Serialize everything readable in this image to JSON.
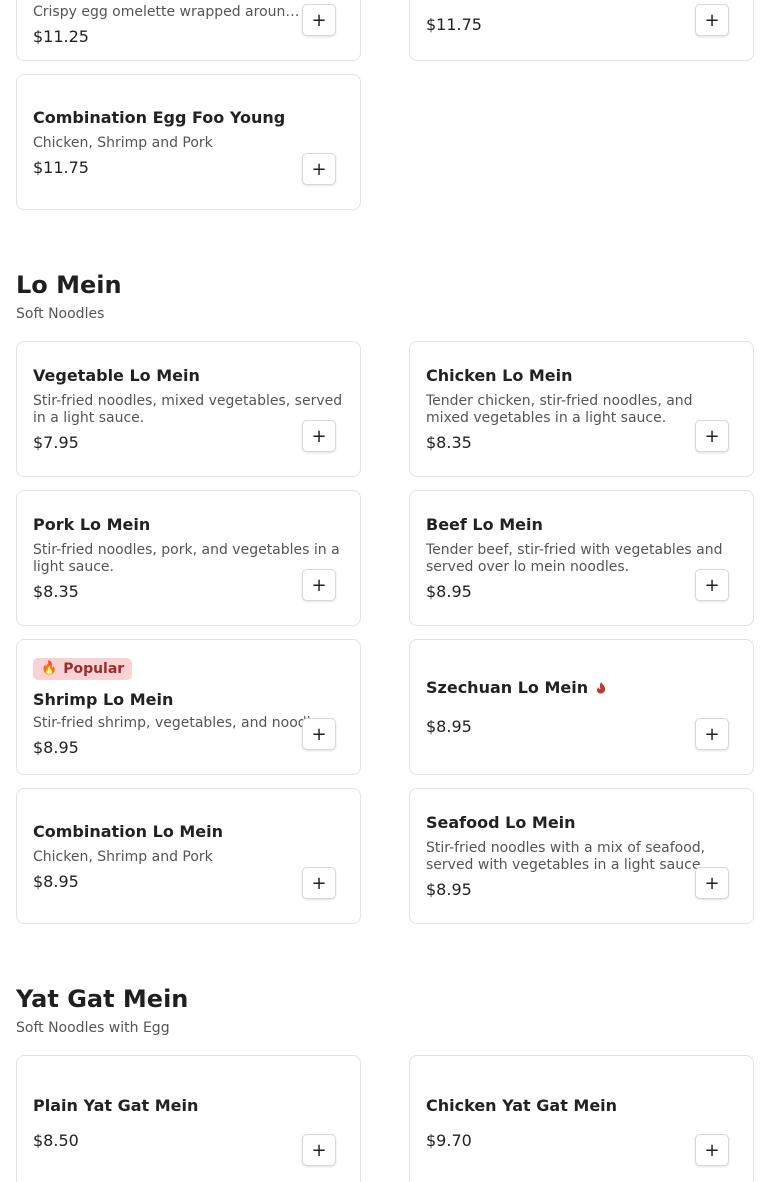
{
  "top_partial": {
    "left": {
      "desc": "Crispy egg omelette wrapped around...",
      "price": "$11.25"
    },
    "right": {
      "price": "$11.75"
    }
  },
  "egg_foo_young_item": {
    "name": "Combination Egg Foo Young",
    "desc": "Chicken, Shrimp and Pork",
    "price": "$11.75"
  },
  "add_label": "+",
  "lo_mein": {
    "title": "Lo Mein",
    "subtitle": "Soft Noodles",
    "items": [
      {
        "name": "Vegetable Lo Mein",
        "desc": "Stir-fried noodles, mixed vegetables, served in a light sauce.",
        "price": "$7.95"
      },
      {
        "name": "Chicken Lo Mein",
        "desc": "Tender chicken, stir-fried noodles, and mixed vegetables in a light sauce.",
        "price": "$8.35"
      },
      {
        "name": "Pork Lo Mein",
        "desc": "Stir-fried noodles, pork, and vegetables in a light sauce.",
        "price": "$8.35"
      },
      {
        "name": "Beef Lo Mein",
        "desc": "Tender beef, stir-fried with vegetables and served over lo mein noodles.",
        "price": "$8.95"
      },
      {
        "badge": "Popular",
        "badge_icon": "fire-icon",
        "name": "Shrimp Lo Mein",
        "desc": "Stir-fried shrimp, vegetables, and noodles.",
        "price": "$8.95"
      },
      {
        "name": "Szechuan Lo Mein",
        "spicy_icon": "chili-icon",
        "spicy_color": "#c0392b",
        "price": "$8.95"
      },
      {
        "name": "Combination Lo Mein",
        "desc": "Chicken, Shrimp and Pork",
        "price": "$8.95"
      },
      {
        "name": "Seafood Lo Mein",
        "desc": "Stir-fried noodles with a mix of seafood, served with vegetables in a light sauce.",
        "price": "$8.95"
      }
    ]
  },
  "yat_gat_mein": {
    "title": "Yat Gat Mein",
    "subtitle": "Soft Noodles with Egg",
    "items": [
      {
        "name": "Plain Yat Gat Mein",
        "price": "$8.50"
      },
      {
        "name": "Chicken Yat Gat Mein",
        "price": "$9.70"
      }
    ]
  }
}
